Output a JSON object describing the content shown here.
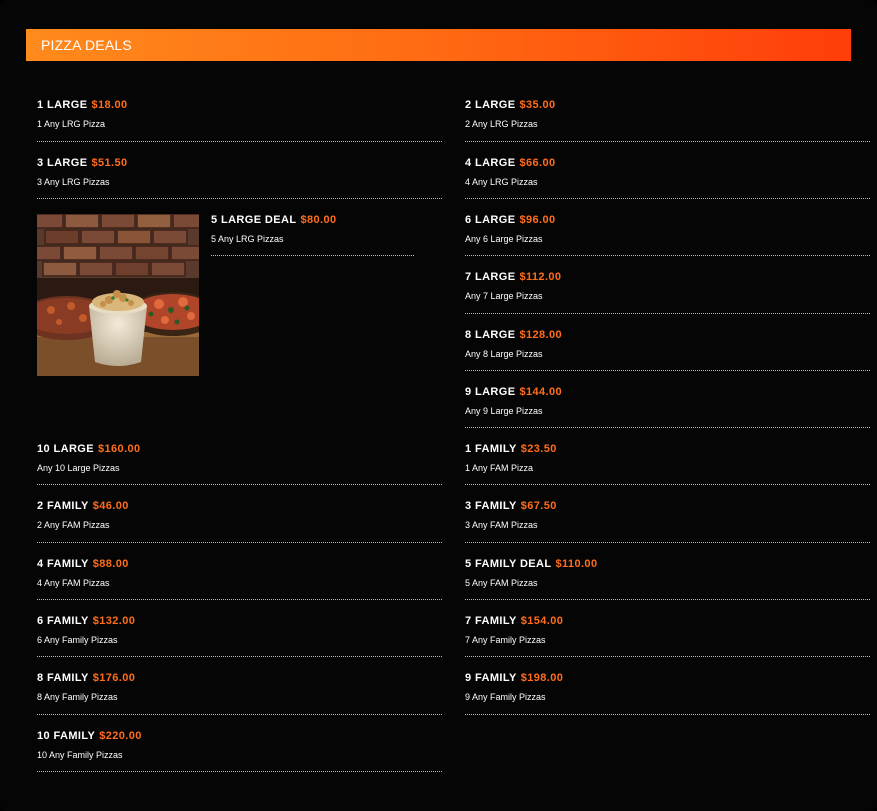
{
  "header": {
    "title": "PIZZA DEALS"
  },
  "deals": [
    {
      "name": "1 LARGE",
      "price": "$18.00",
      "desc": "1 Any LRG Pizza"
    },
    {
      "name": "2 LARGE",
      "price": "$35.00",
      "desc": "2 Any LRG Pizzas"
    },
    {
      "name": "3 LARGE",
      "price": "$51.50",
      "desc": "3 Any LRG Pizzas"
    },
    {
      "name": "4 LARGE",
      "price": "$66.00",
      "desc": "4 Any LRG Pizzas"
    },
    {
      "name": "5 LARGE DEAL",
      "price": "$80.00",
      "desc": "5 Any LRG Pizzas"
    },
    {
      "name": "6 LARGE",
      "price": "$96.00",
      "desc": "Any 6 Large Pizzas"
    },
    {
      "name": "7 LARGE",
      "price": "$112.00",
      "desc": "Any 7 Large Pizzas"
    },
    {
      "name": "8 LARGE",
      "price": "$128.00",
      "desc": "Any 8 Large Pizzas"
    },
    {
      "name": "9 LARGE",
      "price": "$144.00",
      "desc": "Any 9 Large Pizzas"
    },
    {
      "name": "10 LARGE",
      "price": "$160.00",
      "desc": "Any 10 Large Pizzas"
    },
    {
      "name": "1 FAMILY",
      "price": "$23.50",
      "desc": "1 Any FAM Pizza"
    },
    {
      "name": "2 FAMILY",
      "price": "$46.00",
      "desc": "2 Any FAM Pizzas"
    },
    {
      "name": "3 FAMILY",
      "price": "$67.50",
      "desc": "3 Any FAM Pizzas"
    },
    {
      "name": "4 FAMILY",
      "price": "$88.00",
      "desc": "4 Any FAM Pizzas"
    },
    {
      "name": "5 FAMILY DEAL",
      "price": "$110.00",
      "desc": "5 Any FAM Pizzas"
    },
    {
      "name": "6 FAMILY",
      "price": "$132.00",
      "desc": "6 Any Family Pizzas"
    },
    {
      "name": "7 FAMILY",
      "price": "$154.00",
      "desc": "7 Any Family Pizzas"
    },
    {
      "name": "8 FAMILY",
      "price": "$176.00",
      "desc": "8 Any Family Pizzas"
    },
    {
      "name": "9 FAMILY",
      "price": "$198.00",
      "desc": "9 Any Family Pizzas"
    },
    {
      "name": "10 FAMILY",
      "price": "$220.00",
      "desc": "10 Any Family Pizzas"
    }
  ],
  "colors": {
    "accent": "#ff6d1b",
    "header_start": "#ff8a1c",
    "header_end": "#ff3d0a",
    "background": "#050505"
  }
}
